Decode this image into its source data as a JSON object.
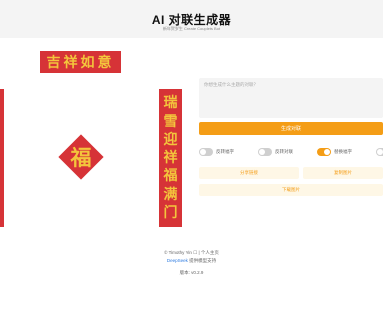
{
  "header": {
    "title": "AI 对联生成器",
    "subtitle": "新年贺岁生 Create Couplets Bot"
  },
  "display": {
    "hengpi": "吉祥如意",
    "fu": "福",
    "couplet_right": [
      "瑞",
      "雪",
      "迎",
      "祥",
      "福",
      "满",
      "门"
    ]
  },
  "form": {
    "input_placeholder": "你想生成什么主题的对联？",
    "generate_label": "生成对联",
    "toggles": [
      {
        "label": "反转福字",
        "on": false
      },
      {
        "label": "反转对联",
        "on": false
      },
      {
        "label": "替换福字",
        "on": true
      }
    ],
    "share_label": "分享链接",
    "copy_label": "复制图片",
    "download_label": "下载图片"
  },
  "footer": {
    "copyright": "© Timothy Yin",
    "separator": "|",
    "personal_link": "个人主页",
    "powered_link": "DeepSeek",
    "powered_text": "提供模型支持",
    "version": "版本: v0.2.9"
  },
  "colors": {
    "red": "#d63337",
    "gold": "#f3c53c",
    "accent": "#f49d16"
  }
}
